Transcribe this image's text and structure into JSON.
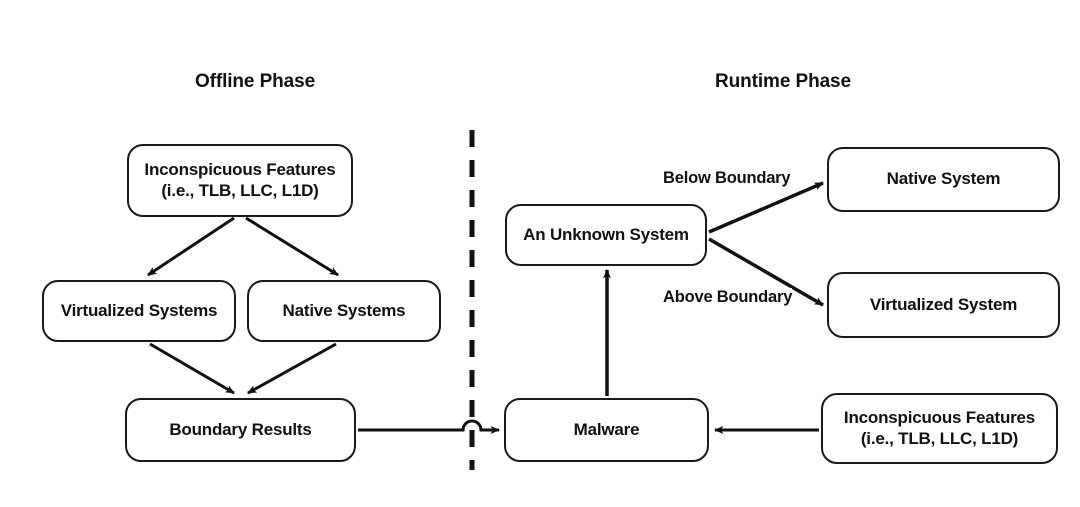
{
  "diagram": {
    "title_offline": "Offline Phase",
    "title_runtime": "Runtime Phase",
    "divider": "dashed-vertical-separator",
    "colors": {
      "stroke": "#1a1a1a",
      "text": "#111111",
      "background": "#ffffff"
    },
    "nodes": [
      {
        "id": "offline-features",
        "label": "Inconspicuous Features\n(i.e., TLB, LLC, L1D)"
      },
      {
        "id": "virtualized-systems",
        "label": "Virtualized Systems"
      },
      {
        "id": "native-systems",
        "label": "Native Systems"
      },
      {
        "id": "boundary-results",
        "label": "Boundary Results"
      },
      {
        "id": "unknown-system",
        "label": "An Unknown System"
      },
      {
        "id": "native-system",
        "label": "Native System"
      },
      {
        "id": "virtualized-system",
        "label": "Virtualized System"
      },
      {
        "id": "malware",
        "label": "Malware"
      },
      {
        "id": "runtime-features",
        "label": "Inconspicuous Features\n(i.e., TLB, LLC, L1D)"
      }
    ],
    "edge_labels": {
      "below_boundary": "Below Boundary",
      "above_boundary": "Above Boundary"
    },
    "edges": [
      {
        "from": "offline-features",
        "to": "virtualized-systems",
        "label": ""
      },
      {
        "from": "offline-features",
        "to": "native-systems",
        "label": ""
      },
      {
        "from": "virtualized-systems",
        "to": "boundary-results",
        "label": ""
      },
      {
        "from": "native-systems",
        "to": "boundary-results",
        "label": ""
      },
      {
        "from": "boundary-results",
        "to": "malware",
        "label": ""
      },
      {
        "from": "malware",
        "to": "unknown-system",
        "label": ""
      },
      {
        "from": "runtime-features",
        "to": "malware",
        "label": ""
      },
      {
        "from": "unknown-system",
        "to": "native-system",
        "label": "Below Boundary"
      },
      {
        "from": "unknown-system",
        "to": "virtualized-system",
        "label": "Above Boundary"
      }
    ]
  }
}
